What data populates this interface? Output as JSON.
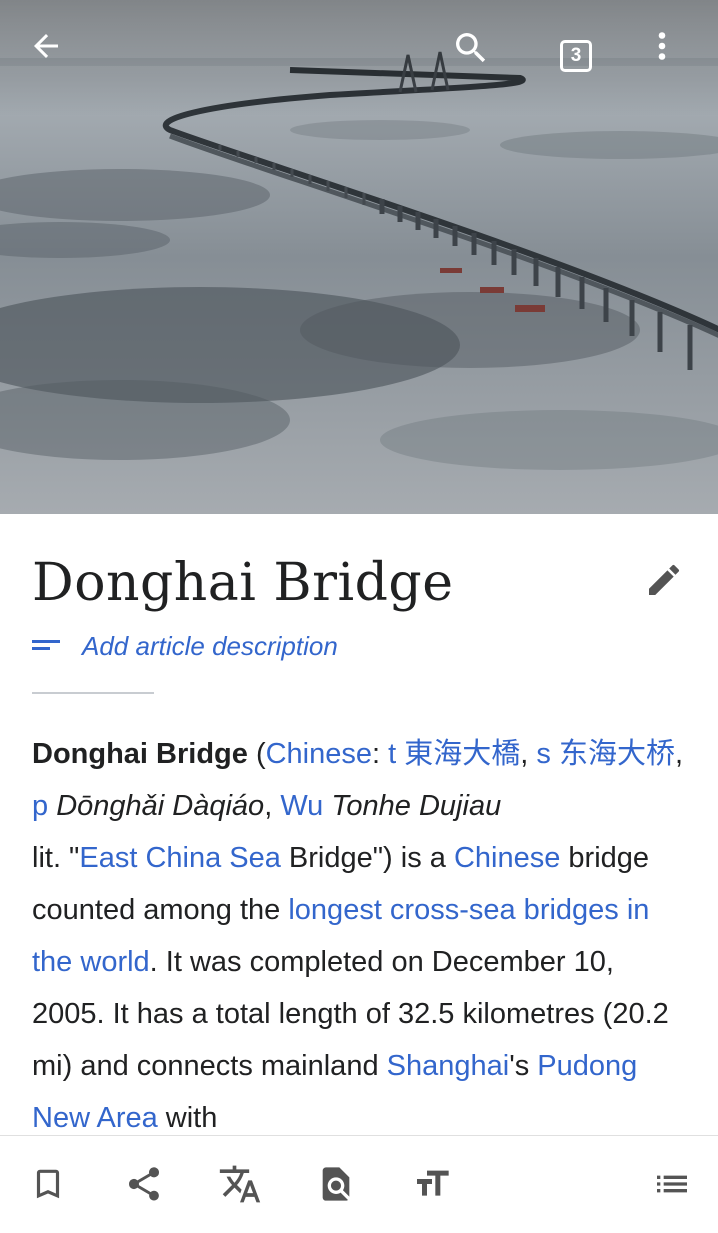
{
  "colors": {
    "link": "#3366cc",
    "text": "#202122",
    "icon": "#545454"
  },
  "topbar": {
    "back_icon": "arrow-left-icon",
    "search_icon": "search-icon",
    "tab_count": "3",
    "overflow_icon": "more-vert-icon"
  },
  "article": {
    "title": "Donghai Bridge",
    "edit_icon": "pencil-icon",
    "description_placeholder": "Add article description",
    "lead": {
      "s1": "Donghai Bridge",
      "s2": " (",
      "s3": "Chinese",
      "s4": ": ",
      "s5": "t 東海大橋",
      "s6": ", ",
      "s7": "s 东海大桥",
      "s8": ", ",
      "s9": "p",
      "s10": " ",
      "s11": "Dōnghǎi Dàqiáo",
      "s12": ", ",
      "s13": "Wu",
      "s14": " ",
      "s15": "Tonhe Dujiau",
      "s16": " lit. \"",
      "s17": "East China Sea",
      "s18": " Bridge\") is a ",
      "s19": "Chinese",
      "s20": " bridge counted among the ",
      "s21": "longest cross-sea bridges in the world",
      "s22": ". It was completed on December 10, 2005. It has a total length of 32.5 kilometres (20.2 mi) and connects mainland ",
      "s23": "Shanghai",
      "s24": "'s ",
      "s25": "Pudong New Area",
      "s26": " with"
    }
  },
  "bottombar": {
    "items": [
      "bookmark-icon",
      "share-icon",
      "translate-icon",
      "find-in-page-icon",
      "text-size-icon",
      "contents-icon"
    ]
  }
}
